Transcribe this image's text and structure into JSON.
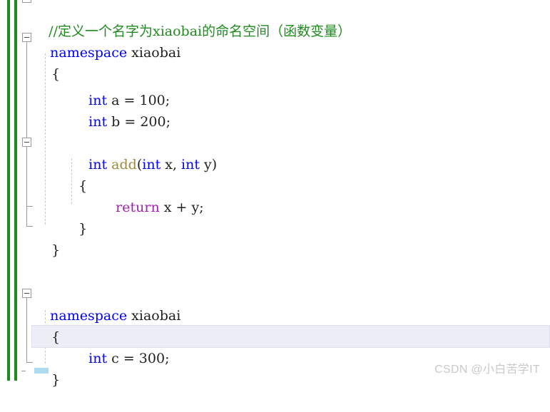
{
  "app": {
    "kind": "code-editor",
    "language": "C++",
    "theme": "light"
  },
  "colors": {
    "background": "#ffffff",
    "keyword": "#0000ff",
    "comment": "#1f8b1f",
    "function": "#9b8a3f",
    "control_keyword": "#a020b0",
    "plain_text": "#1f1f1f",
    "change_bar_saved": "#1f8b1f",
    "outline_line": "#9a9a9a",
    "indent_guide": "#c8c8c8",
    "current_line_highlight": "#eceef6",
    "selection": "#addaef",
    "watermark": "#c9c9c9"
  },
  "code": {
    "lines": [
      {
        "id": "line-comment",
        "indent": 0,
        "tokens": [
          {
            "text": "//定义一个名字为xiaobai的命名空间（函数变量）",
            "type": "comment"
          }
        ]
      },
      {
        "id": "line-namespace-1",
        "indent": 0,
        "tokens": [
          {
            "text": "namespace",
            "type": "keyword"
          },
          {
            "text": " xiaobai",
            "type": "plain"
          }
        ]
      },
      {
        "id": "line-open-brace-1",
        "indent": 1,
        "tokens": [
          {
            "text": "{",
            "type": "plain"
          }
        ]
      },
      {
        "id": "line-int-a",
        "indent": 2,
        "tokens": [
          {
            "text": "int",
            "type": "keyword"
          },
          {
            "text": " a = 100;",
            "type": "plain"
          }
        ]
      },
      {
        "id": "line-int-b",
        "indent": 2,
        "tokens": [
          {
            "text": "int",
            "type": "keyword"
          },
          {
            "text": " b = 200;",
            "type": "plain"
          }
        ]
      },
      {
        "id": "line-blank-1",
        "indent": 0,
        "tokens": []
      },
      {
        "id": "line-func-add",
        "indent": 2,
        "tokens": [
          {
            "text": "int",
            "type": "keyword"
          },
          {
            "text": " ",
            "type": "plain"
          },
          {
            "text": "add",
            "type": "function"
          },
          {
            "text": "(",
            "type": "plain"
          },
          {
            "text": "int",
            "type": "keyword"
          },
          {
            "text": " x, ",
            "type": "plain"
          },
          {
            "text": "int",
            "type": "keyword"
          },
          {
            "text": " y)",
            "type": "plain"
          }
        ]
      },
      {
        "id": "line-open-brace-2",
        "indent": 2,
        "tokens": [
          {
            "text": "{",
            "type": "plain"
          }
        ]
      },
      {
        "id": "line-return",
        "indent": 3,
        "tokens": [
          {
            "text": "return",
            "type": "control"
          },
          {
            "text": " x + y;",
            "type": "plain"
          }
        ]
      },
      {
        "id": "line-close-brace-2",
        "indent": 2,
        "tokens": [
          {
            "text": "}",
            "type": "plain"
          }
        ]
      },
      {
        "id": "line-close-brace-1",
        "indent": 1,
        "tokens": [
          {
            "text": "}",
            "type": "plain"
          }
        ]
      },
      {
        "id": "line-blank-2",
        "indent": 0,
        "tokens": []
      },
      {
        "id": "line-blank-3",
        "indent": 0,
        "tokens": []
      },
      {
        "id": "line-namespace-2",
        "indent": 0,
        "tokens": [
          {
            "text": "namespace",
            "type": "keyword"
          },
          {
            "text": " xiaobai",
            "type": "plain"
          }
        ]
      },
      {
        "id": "line-open-brace-3",
        "indent": 1,
        "tokens": [
          {
            "text": "{",
            "type": "plain"
          }
        ]
      },
      {
        "id": "line-int-c",
        "indent": 2,
        "highlighted": true,
        "tokens": [
          {
            "text": "int",
            "type": "keyword"
          },
          {
            "text": " c = 300;",
            "type": "plain"
          }
        ]
      },
      {
        "id": "line-close-brace-3",
        "indent": 1,
        "tokens": [
          {
            "text": "}",
            "type": "plain"
          }
        ]
      }
    ]
  },
  "outlining": {
    "regions": [
      {
        "id": "region-top-partial",
        "label": "collapse-toggle",
        "state": "expanded"
      },
      {
        "id": "region-namespace-1",
        "label": "collapse-toggle",
        "state": "expanded"
      },
      {
        "id": "region-func-add",
        "label": "collapse-toggle",
        "state": "expanded"
      },
      {
        "id": "region-namespace-2",
        "label": "collapse-toggle",
        "state": "expanded"
      }
    ]
  },
  "watermark": {
    "text": "CSDN @小白苦学IT"
  }
}
